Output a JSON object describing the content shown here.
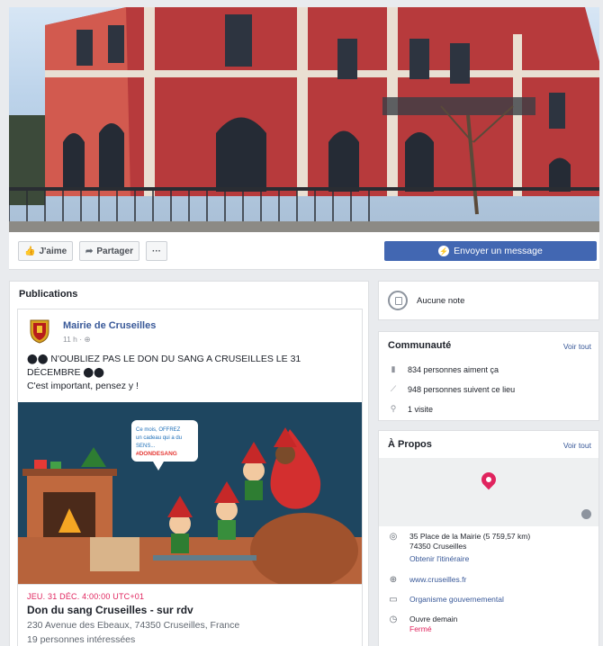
{
  "actions": {
    "like_label": "J'aime",
    "share_label": "Partager",
    "more_label": "···",
    "message_label": "Envoyer un message"
  },
  "publications": {
    "title": "Publications",
    "post": {
      "author": "Mairie de Cruseilles",
      "meta": "11 h · ⊕",
      "text_line1": "⬤⬤ N'OUBLIEZ PAS LE DON DU SANG A CRUSEILLES LE 31",
      "text_line2": "DÉCEMBRE ⬤⬤",
      "text_line3": "C'est important, pensez y !",
      "image_bubble": [
        "Ce mois, OFFREZ",
        "un cadeau qui a du",
        "SENS...",
        "#DONDESANG"
      ]
    },
    "event": {
      "date": "JEU. 31 DÉC. 4:00:00 UTC+01",
      "title": "Don du sang Cruseilles - sur rdv",
      "address": "230 Avenue des Ebeaux, 74350 Cruseilles, France",
      "interested": "19 personnes intéressées"
    }
  },
  "note": {
    "label": "Aucune note"
  },
  "communaute": {
    "title": "Communauté",
    "see_all": "Voir tout",
    "likes": "834 personnes aiment ça",
    "follows": "948 personnes suivent ce lieu",
    "visits": "1 visite"
  },
  "apropos": {
    "title": "À Propos",
    "see_all": "Voir tout",
    "address_line1": "35 Place de la Mairie (5 759,57 km)",
    "address_line2": "74350 Cruseilles",
    "directions": "Obtenir l'itinéraire",
    "website": "www.cruseilles.fr",
    "category": "Organisme gouvernemental",
    "hours": "Ouvre demain",
    "status": "Fermé"
  },
  "colors": {
    "brand_blue": "#4267b2",
    "link_blue": "#385898",
    "accent_red": "#e0245e",
    "background": "#e9ebee"
  },
  "icons": [
    "thumbs-up-icon",
    "share-icon",
    "more-icon",
    "messenger-icon",
    "note-icon",
    "like-count-icon",
    "follow-icon",
    "checkin-icon",
    "location-icon",
    "globe-icon",
    "category-icon",
    "clock-icon",
    "map-pin-icon"
  ]
}
